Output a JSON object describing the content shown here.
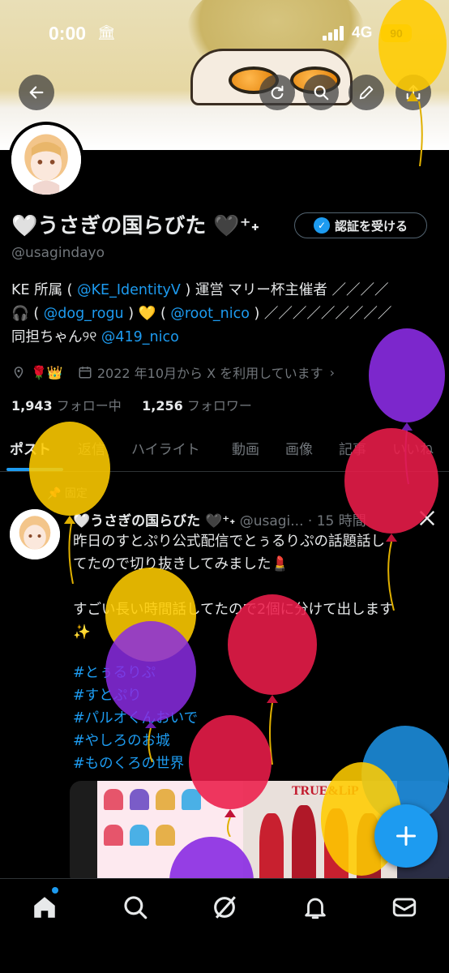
{
  "status_bar": {
    "time": "0:00",
    "network": "4G",
    "battery": "90"
  },
  "header": {
    "back_icon": "arrow-left-icon",
    "actions": [
      "refresh-icon",
      "search-icon",
      "edit-icon",
      "share-icon"
    ]
  },
  "profile": {
    "display_name": "🤍うさぎの国らびた 🖤⁺˖",
    "verify_button": "認証を受ける",
    "handle": "@usagindayo",
    "bio": {
      "line1": {
        "a": "KE 所属 ( ",
        "m1": "@KE_IdentityV",
        "b": " ) 運営 マリー杯主催者 ／／／／"
      },
      "line2": {
        "a": "🎧 ( ",
        "m1": "@dog_rogu",
        "b": " ) 💛 ( ",
        "m2": "@root_nico",
        "c": " ) ／／／／／／／／／"
      },
      "line3": {
        "a": "同担ちゃん୨୧ ",
        "m1": "@419_nico"
      }
    },
    "location": "🌹👑",
    "joined": "2022 年10月から X を利用しています",
    "following_count": "1,943",
    "following_label": "フォロー中",
    "followers_count": "1,256",
    "followers_label": "フォロワー"
  },
  "tabs": [
    "ポスト",
    "返信",
    "ハイライト",
    "動画",
    "画像",
    "記事",
    "いいね"
  ],
  "pinned_post": {
    "pinned_label": "固定",
    "author": "🤍うさぎの国らびた 🖤⁺˖",
    "handle": "@usagi...",
    "time": "· 15 時間",
    "text": "昨日のすとぷり公式配信でとぅるりぷの話題話し\nてたので切り抜きしてみました💄\n\nすごい長い時間話してたので2個に分けて出します\n✨",
    "hashtags": [
      "#とぅるりぷ",
      "#すとぷり",
      "#パルオくんおいで",
      "#やしろのお城",
      "#ものくろの世界"
    ],
    "media_caption": "TRUE&LiP"
  },
  "bottom_nav": [
    "home-icon",
    "search-icon",
    "grok-icon",
    "notifications-icon",
    "messages-icon"
  ],
  "colors": {
    "accent": "#1d9bf0",
    "text": "#e7e9ea",
    "muted": "#71767b",
    "background": "#000000"
  }
}
